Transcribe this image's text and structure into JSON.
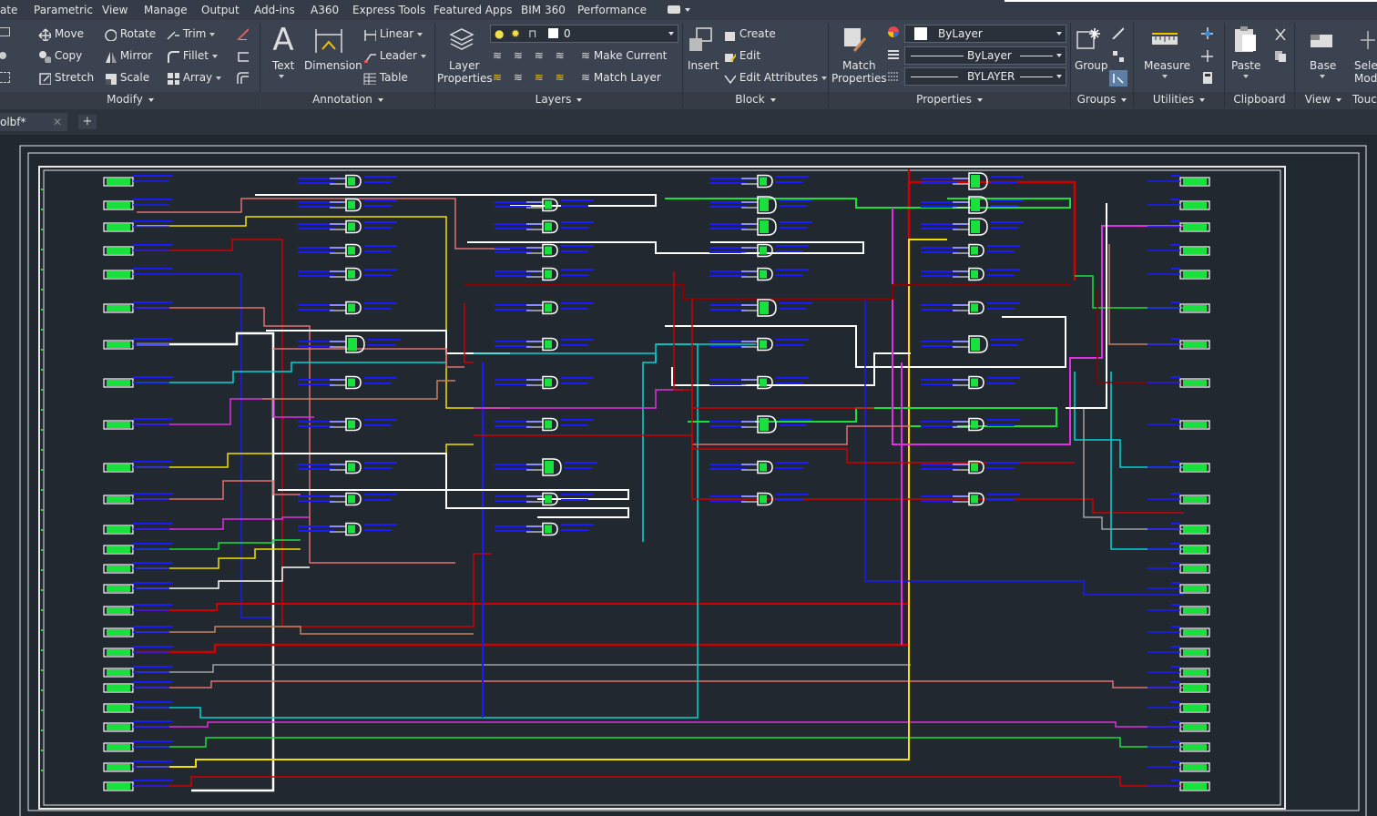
{
  "menu_tabs": [
    "ate",
    "Parametric",
    "View",
    "Manage",
    "Output",
    "Add-ins",
    "A360",
    "Express Tools",
    "Featured Apps",
    "BIM 360",
    "Performance"
  ],
  "modify": {
    "move": "Move",
    "rotate": "Rotate",
    "trim": "Trim",
    "copy": "Copy",
    "mirror": "Mirror",
    "fillet": "Fillet",
    "stretch": "Stretch",
    "scale": "Scale",
    "array": "Array",
    "panel": "Modify"
  },
  "annotation": {
    "text": "Text",
    "dimension": "Dimension",
    "linear": "Linear",
    "leader": "Leader",
    "table": "Table",
    "panel": "Annotation"
  },
  "layers": {
    "layer_props_1": "Layer",
    "layer_props_2": "Properties",
    "current_layer": "0",
    "make_current": "Make Current",
    "match_layer": "Match Layer",
    "panel": "Layers"
  },
  "block": {
    "insert": "Insert",
    "create": "Create",
    "edit": "Edit",
    "edit_attributes": "Edit Attributes",
    "panel": "Block"
  },
  "properties": {
    "match_1": "Match",
    "match_2": "Properties",
    "color": "ByLayer",
    "linetype": "ByLayer",
    "lineweight": "BYLAYER",
    "panel": "Properties"
  },
  "groups": {
    "group": "Group",
    "panel": "Groups"
  },
  "utilities": {
    "measure": "Measure",
    "panel": "Utilities"
  },
  "clipboard": {
    "paste": "Paste",
    "panel": "Clipboard"
  },
  "view": {
    "base": "Base",
    "select_1": "Selec",
    "select_2": "Mod",
    "panel": "View",
    "touch": "Touc"
  },
  "file_tab": {
    "name": "olbf*"
  },
  "colors": {
    "canvas": "#212830",
    "ribbon": "#3b4350",
    "gate_green": "#19e03c",
    "label_blue": "#1a1aff"
  }
}
